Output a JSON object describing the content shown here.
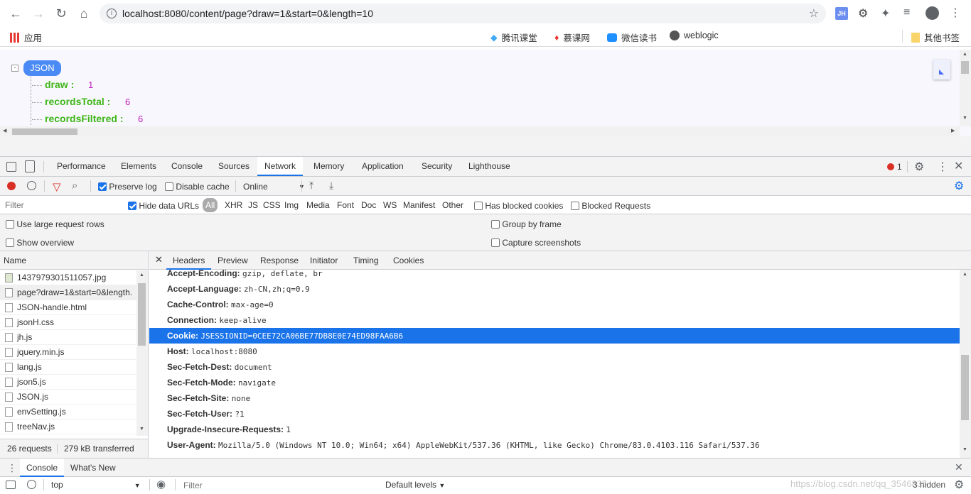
{
  "browser": {
    "url": "localhost:8080/content/page?draw=1&start=0&length=10",
    "bookmarks": {
      "apps": "应用",
      "items": [
        "腾讯课堂",
        "慕课网",
        "微信读书",
        "weblogic"
      ],
      "other": "其他书签"
    },
    "ext_badge": "JH"
  },
  "json_view": {
    "root": "JSON",
    "fields": [
      {
        "key": "draw :",
        "value": "1"
      },
      {
        "key": "recordsTotal :",
        "value": "6"
      },
      {
        "key": "recordsFiltered :",
        "value": "6"
      }
    ]
  },
  "devtools": {
    "tabs": [
      "Performance",
      "Elements",
      "Console",
      "Sources",
      "Network",
      "Memory",
      "Application",
      "Security",
      "Lighthouse"
    ],
    "active_tab": "Network",
    "error_count": "1",
    "toolbar": {
      "preserve_log": "Preserve log",
      "disable_cache": "Disable cache",
      "throttle": "Online"
    },
    "filter": {
      "placeholder": "Filter",
      "hide_data_urls": "Hide data URLs",
      "types": [
        "All",
        "XHR",
        "JS",
        "CSS",
        "Img",
        "Media",
        "Font",
        "Doc",
        "WS",
        "Manifest",
        "Other"
      ],
      "has_blocked_cookies": "Has blocked cookies",
      "blocked_requests": "Blocked Requests"
    },
    "options": {
      "large_rows": "Use large request rows",
      "show_overview": "Show overview",
      "group_by_frame": "Group by frame",
      "capture_screenshots": "Capture screenshots"
    },
    "name_header": "Name",
    "files": [
      "1437979301511057.jpg",
      "page?draw=1&start=0&length.",
      "JSON-handle.html",
      "jsonH.css",
      "jh.js",
      "jquery.min.js",
      "lang.js",
      "json5.js",
      "JSON.js",
      "envSetting.js",
      "treeNav.js"
    ],
    "status": {
      "requests": "26 requests",
      "transferred": "279 kB transferred"
    },
    "detail_tabs": [
      "Headers",
      "Preview",
      "Response",
      "Initiator",
      "Timing",
      "Cookies"
    ],
    "headers": [
      {
        "k": "Accept-Encoding:",
        "v": "gzip, deflate, br"
      },
      {
        "k": "Accept-Language:",
        "v": "zh-CN,zh;q=0.9"
      },
      {
        "k": "Cache-Control:",
        "v": "max-age=0"
      },
      {
        "k": "Connection:",
        "v": "keep-alive"
      },
      {
        "k": "Cookie:",
        "v": "JSESSIONID=0CEE72CA06BE77DB8E0E74ED98FAA6B6"
      },
      {
        "k": "Host:",
        "v": "localhost:8080"
      },
      {
        "k": "Sec-Fetch-Dest:",
        "v": "document"
      },
      {
        "k": "Sec-Fetch-Mode:",
        "v": "navigate"
      },
      {
        "k": "Sec-Fetch-Site:",
        "v": "none"
      },
      {
        "k": "Sec-Fetch-User:",
        "v": "?1"
      },
      {
        "k": "Upgrade-Insecure-Requests:",
        "v": "1"
      },
      {
        "k": "User-Agent:",
        "v": "Mozilla/5.0 (Windows NT 10.0; Win64; x64) AppleWebKit/537.36 (KHTML, like Gecko) Chrome/83.0.4103.116 Safari/537.36"
      }
    ],
    "drawer": {
      "tabs": [
        "Console",
        "What's New"
      ],
      "context": "top",
      "filter_placeholder": "Filter",
      "levels": "Default levels",
      "hidden": "3 hidden",
      "watermark": "https://blog.csdn.net/qq_3546835"
    }
  }
}
